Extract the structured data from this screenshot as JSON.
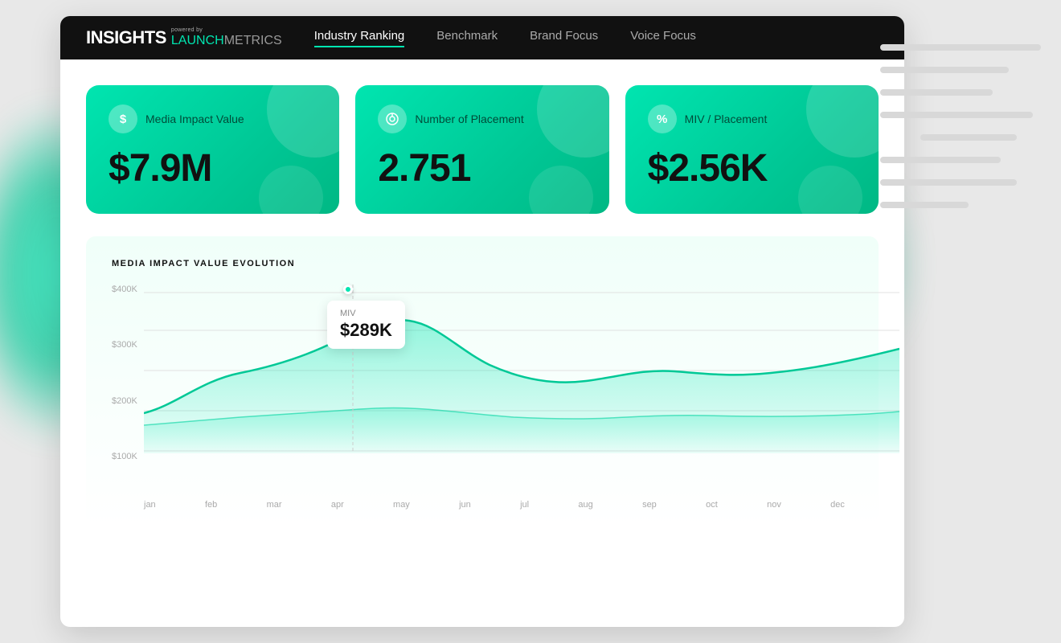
{
  "logo": {
    "insights": "INSIGHTS",
    "powered_by": "powered by",
    "launch": "LAUNCH",
    "metrics": "METRICS"
  },
  "nav": {
    "items": [
      {
        "label": "Industry Ranking",
        "active": true
      },
      {
        "label": "Benchmark",
        "active": false
      },
      {
        "label": "Brand Focus",
        "active": false
      },
      {
        "label": "Voice Focus",
        "active": false
      }
    ]
  },
  "metrics": [
    {
      "icon": "$",
      "label": "Media Impact Value",
      "value": "$7.9M"
    },
    {
      "icon": "◎",
      "label": "Number of Placement",
      "value": "2.751"
    },
    {
      "icon": "%",
      "label": "MIV / Placement",
      "value": "$2.56K"
    }
  ],
  "chart": {
    "title": "MEDIA IMPACT VALUE EVOLUTION",
    "tooltip": {
      "label": "MIV",
      "value": "$289K"
    },
    "y_labels": [
      "$400K",
      "$300K",
      "$200K",
      "$100K"
    ],
    "x_labels": [
      "jan",
      "feb",
      "mar",
      "apr",
      "may",
      "jun",
      "jul",
      "aug",
      "sep",
      "oct",
      "nov",
      "dec"
    ]
  }
}
